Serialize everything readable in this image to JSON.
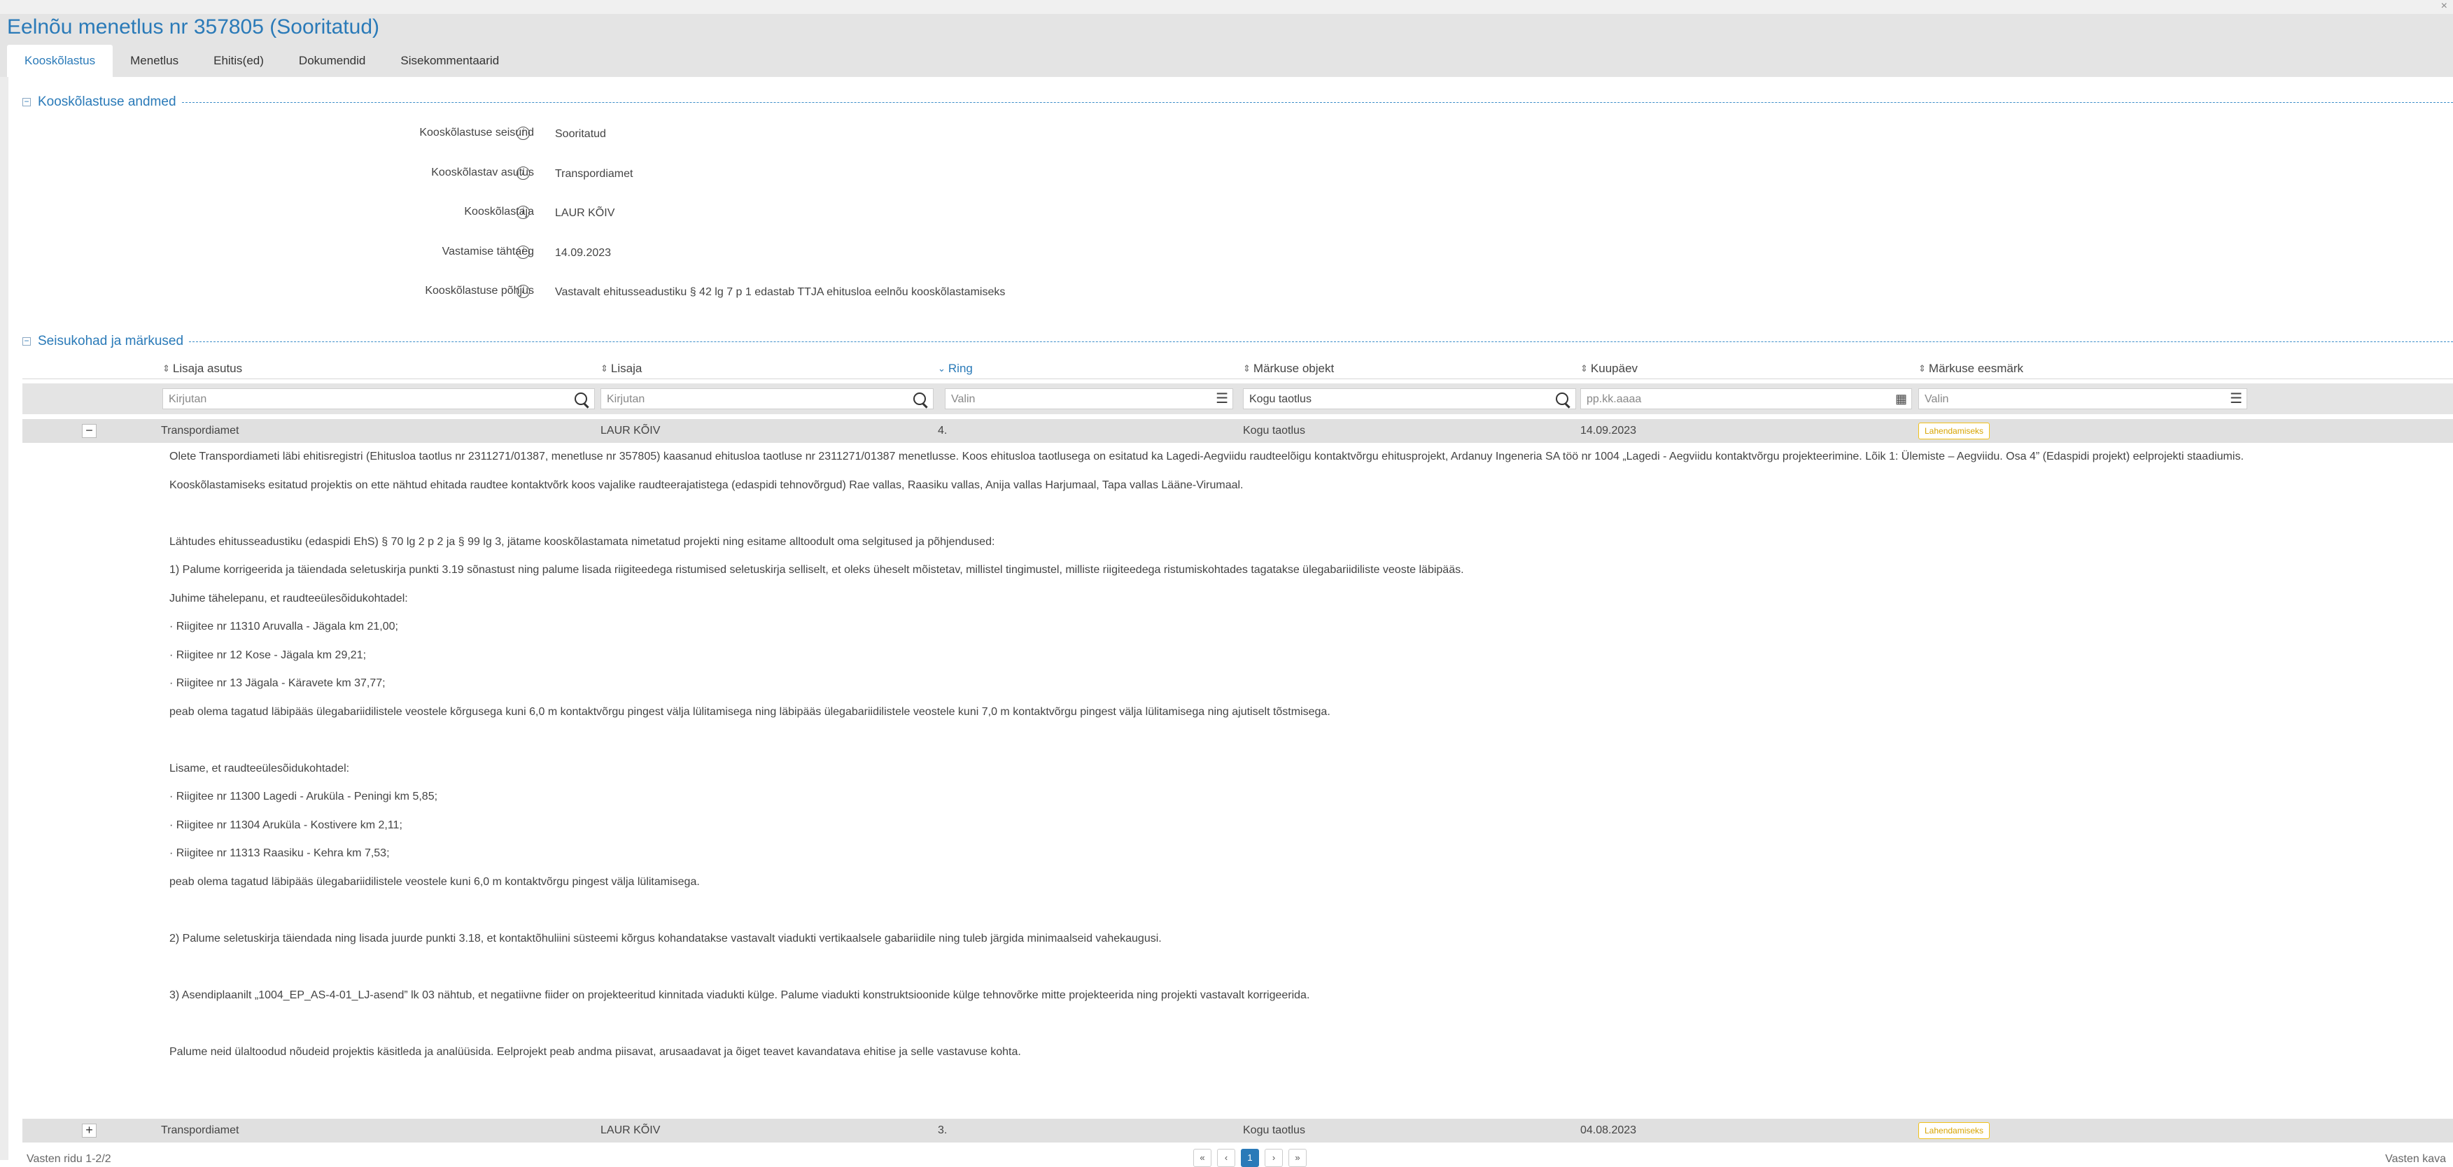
{
  "page": {
    "title": "Eelnõu menetlus nr 357805 (Sooritatud)"
  },
  "tabs": [
    "Kooskõlastus",
    "Menetlus",
    "Ehitis(ed)",
    "Dokumendid",
    "Sisekommentaarid"
  ],
  "section1": {
    "title": "Kooskõlastuse andmed",
    "fields": [
      {
        "label": "Kooskõlastuse seisund",
        "value": "Sooritatud"
      },
      {
        "label": "Kooskõlastav asutus",
        "value": "Transpordiamet"
      },
      {
        "label": "Kooskõlastaja",
        "value": "LAUR KÕIV"
      },
      {
        "label": "Vastamise tähtaeg",
        "value": "14.09.2023"
      },
      {
        "label": "Kooskõlastuse põhjus",
        "value": "Vastavalt ehitusseadustiku § 42 lg 7 p 1 edastab TTJA ehitusloa eelnõu kooskõlastamiseks"
      }
    ]
  },
  "section2": {
    "title": "Seisukohad ja märkused"
  },
  "table": {
    "columns": [
      "Lisaja asutus",
      "Lisaja",
      "Ring",
      "Märkuse objekt",
      "Kuupäev",
      "Märkuse eesmärk"
    ],
    "filters": [
      "Kirjutan",
      "Kirjutan",
      "Valin",
      "Kogu taotlus",
      "pp.kk.aaaa",
      "Valin"
    ],
    "rows": [
      {
        "agency": "Transpordiamet",
        "author": "LAUR KÕIV",
        "round": "4.",
        "object": "Kogu taotlus",
        "date": "14.09.2023",
        "purpose": "Lahendamiseks",
        "toggle": "−"
      },
      {
        "agency": "Transpordiamet",
        "author": "LAUR KÕIV",
        "round": "3.",
        "object": "Kogu taotlus",
        "date": "04.08.2023",
        "purpose": "Lahendamiseks",
        "toggle": "+"
      }
    ],
    "comment_lines": [
      "Olete Transpordiameti läbi ehitisregistri (Ehitusloa taotlus nr 2311271/01387, menetluse nr 357805) kaasanud ehitusloa taotluse nr 2311271/01387  menetlusse. Koos ehitusloa taotlusega on esitatud ka Lagedi-Aegviidu raudteelõigu kontaktvõrgu ehitusprojekt, Ardanuy Ingeneria SA töö nr 1004 „Lagedi - Aegviidu kontaktvõrgu projekteerimine. Lõik 1: Ülemiste – Aegviidu. Osa 4” (Edaspidi projekt) eelprojekti staadiumis.",
      "Kooskõlastamiseks esitatud projektis on ette nähtud ehitada raudtee kontaktvõrk koos vajalike raudteerajatistega (edaspidi tehnovõrgud) Rae vallas, Raasiku vallas, Anija vallas Harjumaal, Tapa vallas Lääne-Virumaal.",
      "",
      "Lähtudes ehitusseadustiku (edaspidi EhS) § 70 lg 2 p 2 ja § 99 lg 3, jätame kooskõlastamata nimetatud projekti ning esitame alltoodult oma selgitused ja põhjendused:",
      "1) Palume korrigeerida ja täiendada seletuskirja punkti 3.19 sõnastust ning palume lisada riigiteedega ristumised seletuskirja selliselt, et oleks üheselt mõistetav, millistel tingimustel, milliste riigiteedega ristumiskohtades tagatakse ülegabariidiliste veoste läbipääs.",
      " Juhime tähelepanu, et raudteeülesõidukohtadel:",
      "· Riigitee nr 11310 Aruvalla - Jägala km 21,00;",
      "· Riigitee nr 12 Kose - Jägala km 29,21;",
      "· Riigitee nr 13 Jägala - Käravete km 37,77;",
      "peab olema tagatud läbipääs ülegabariidilistele veostele kõrgusega kuni 6,0 m kontaktvõrgu pingest välja lülitamisega ning läbipääs ülegabariidilistele veostele kuni 7,0 m kontaktvõrgu pingest välja lülitamisega ning ajutiselt tõstmisega.",
      "",
      "Lisame, et raudteeülesõidukohtadel:",
      "· Riigitee nr 11300 Lagedi - Aruküla - Peningi km 5,85;",
      "· Riigitee nr 11304 Aruküla - Kostivere km 2,11;",
      "· Riigitee nr 11313 Raasiku - Kehra km 7,53;",
      "peab olema tagatud läbipääs ülegabariidilistele veostele kuni 6,0 m kontaktvõrgu pingest välja lülitamisega.",
      "",
      "2) Palume seletuskirja täiendada ning lisada juurde punkti 3.18, et kontaktõhuliini süsteemi kõrgus kohandatakse vastavalt viadukti vertikaalsele gabariidile ning tuleb järgida minimaalseid vahekaugusi.",
      "",
      "3) Asendiplaanilt „1004_EP_AS-4-01_LJ-asend” lk 03 nähtub, et negatiivne fiider on projekteeritud kinnitada viadukti külge. Palume viadukti konstruktsioonide külge tehnovõrke mitte projekteerida ning projekti vastavalt korrigeerida.",
      "",
      "Palume neid ülaltoodud nõudeid projektis käsitleda ja analüüsida. Eelprojekt peab andma piisavat, arusaadavat ja õiget teavet kavandatava ehitise ja selle vastavuse kohta."
    ]
  },
  "footer": {
    "rows_info": "Vasten ridu 1-2/2",
    "page": "1",
    "right_text": "Vasten kava"
  },
  "colors": {
    "accent": "#2a7ab8",
    "badge": "#f2c118",
    "row_bg": "#e0e0e0"
  }
}
